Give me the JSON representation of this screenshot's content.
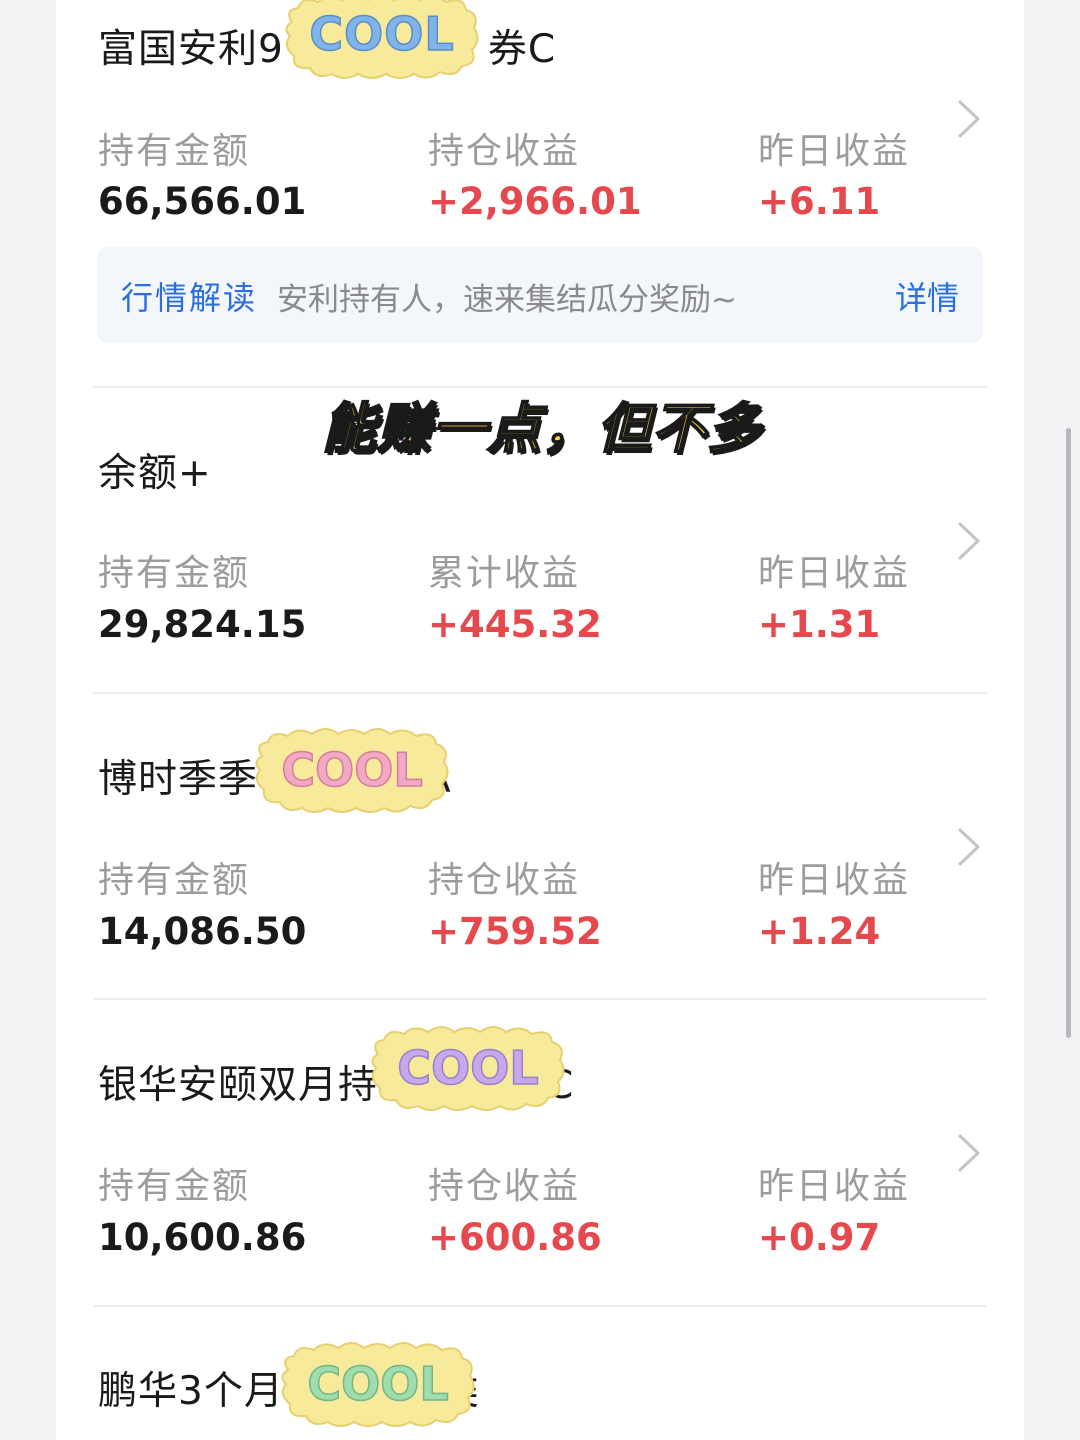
{
  "labels": {
    "holding": "持有金额",
    "position_income": "持仓收益",
    "cumulative_income": "累计收益",
    "yesterday_income": "昨日收益"
  },
  "funds": [
    {
      "name_visible_left": "富国安利9",
      "name_visible_right": "券C",
      "holding_amount": "66,566.01",
      "mid_label": "持仓收益",
      "mid_value": "+2,966.01",
      "yesterday_income": "+6.11"
    },
    {
      "name": "余额+",
      "holding_amount": "29,824.15",
      "mid_label": "累计收益",
      "mid_value": "+445.32",
      "yesterday_income": "+1.31"
    },
    {
      "name_visible_left": "博时季季",
      "name_visible_right": "A",
      "holding_amount": "14,086.50",
      "mid_label": "持仓收益",
      "mid_value": "+759.52",
      "yesterday_income": "+1.24"
    },
    {
      "name_visible_left": "银华安颐双月持",
      "name_visible_right": "C",
      "holding_amount": "10,600.86",
      "mid_label": "持仓收益",
      "mid_value": "+600.86",
      "yesterday_income": "+0.97"
    },
    {
      "name_visible_left": "鹏华3个月",
      "name_visible_right": "类"
    }
  ],
  "promo": {
    "tag": "行情解读",
    "text": "安利持有人，速来集结瓜分奖励~",
    "link": "详情"
  },
  "overlay": {
    "caption": "能赚一点，但不多",
    "sticker_text": "COOL",
    "sticker_letter_colors": [
      "#7fb3ea",
      "#f3a8c4",
      "#f4d27a",
      "#c6a8ec",
      "#9fdcae"
    ],
    "sticker_blob_color": "#f7ea9a"
  },
  "colors": {
    "gain": "#e5484d",
    "link": "#2c6ee0",
    "label": "#9c9c9c",
    "value": "#1a1a1a",
    "caption_fill": "#ffd83a"
  }
}
